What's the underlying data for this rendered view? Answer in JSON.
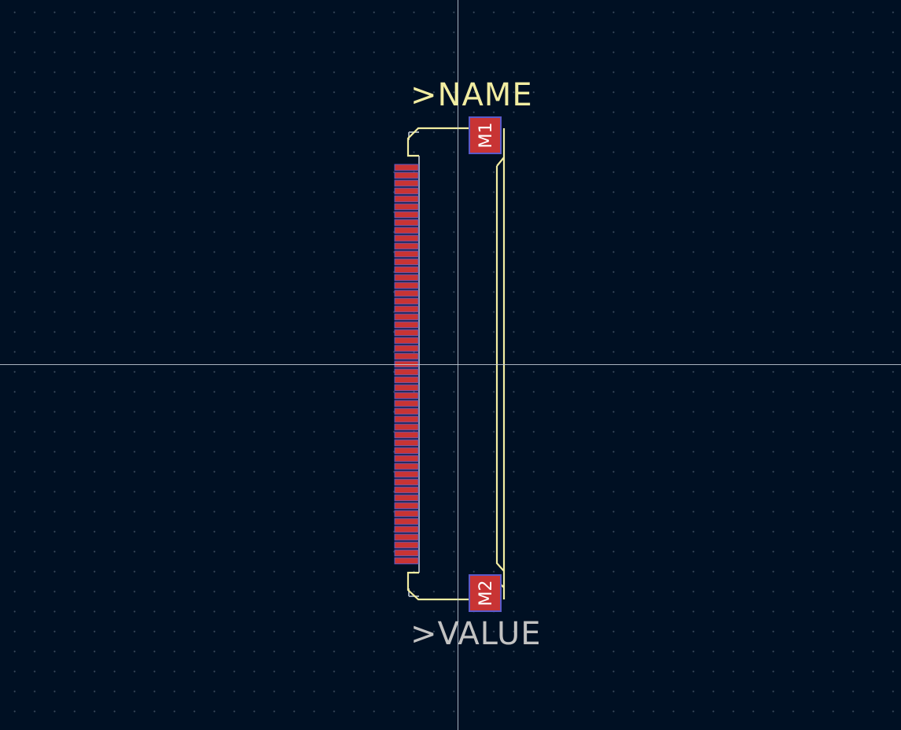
{
  "footprint": {
    "reference_label": ">NAME",
    "value_label": ">VALUE",
    "mount_pads": [
      "M1",
      "M2"
    ],
    "signal_pad_count": 51
  },
  "colors": {
    "background": "#001023",
    "silkscreen": "#f2eda1",
    "value_text": "#c2c2c2",
    "pad_fill": "#c83434",
    "pad_outline": "#5a5ac8",
    "courtyard": "#c2c2c2"
  }
}
